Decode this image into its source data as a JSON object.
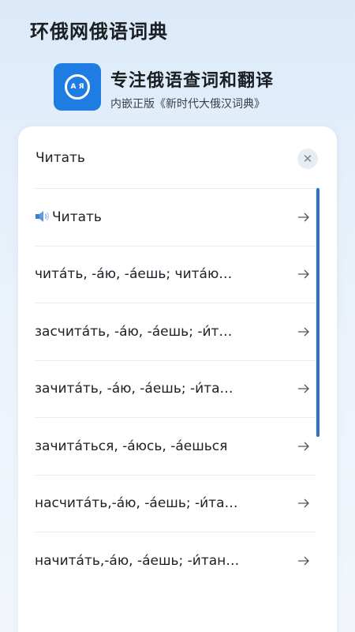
{
  "header": {
    "title": "环俄网俄语词典",
    "app_icon_text": "A Я",
    "headline": "专注俄语查词和翻译",
    "subline": "内嵌正版《新时代大俄汉词典》"
  },
  "search": {
    "query": "Читать",
    "clear_icon": "close-icon"
  },
  "results": [
    {
      "text": "Читать",
      "icon": "speaker-icon"
    },
    {
      "text": "чита́ть, -а́ю, -а́ешь; чита́ю…"
    },
    {
      "text": "засчита́ть, -а́ю, -а́ешь; -и́т…"
    },
    {
      "text": "зачита́ть, -а́ю, -а́ешь; -и́та…"
    },
    {
      "text": "зачита́ться, -а́юсь, -а́ешься"
    },
    {
      "text": "насчита́ть,-а́ю, -а́ешь; -и́та…"
    },
    {
      "text": "начита́ть,-а́ю, -а́ешь; -и́тан…"
    }
  ],
  "colors": {
    "accent": "#1f7ce3",
    "scrollbar": "#2f73c6",
    "background_top": "#dbe9f9"
  }
}
